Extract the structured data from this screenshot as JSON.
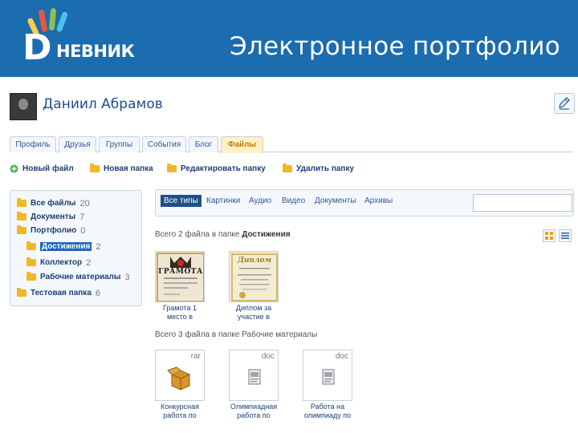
{
  "header": {
    "logo_text": "НЕВНИК",
    "logo_letter": "D",
    "title": "Электронное портфолио",
    "bg_color": "#1c6cb0"
  },
  "profile": {
    "name": "Даниил Абрамов",
    "edit_icon": "pencil-icon"
  },
  "tabs": [
    {
      "label": "Профиль"
    },
    {
      "label": "Друзья"
    },
    {
      "label": "Группы"
    },
    {
      "label": "События"
    },
    {
      "label": "Блог"
    },
    {
      "label": "Файлы",
      "active": true
    }
  ],
  "toolbar": {
    "new_file": "Новый файл",
    "new_folder": "Новая папка",
    "edit_folder": "Редактировать папку",
    "delete_folder": "Удалить папку"
  },
  "tree": [
    {
      "label": "Все файлы",
      "count": "20"
    },
    {
      "label": "Документы",
      "count": "7"
    },
    {
      "label": "Портфолио",
      "count": "0"
    },
    {
      "label": "Достижения",
      "count": "2",
      "selected": true
    },
    {
      "label": "Коллектор",
      "count": "2"
    },
    {
      "label": "Рабочие материалы",
      "count": "3"
    },
    {
      "label": "Тестовая папка",
      "count": "6"
    }
  ],
  "filter_tabs": [
    {
      "label": "Все типы",
      "active": true
    },
    {
      "label": "Картинки"
    },
    {
      "label": "Аудио"
    },
    {
      "label": "Видео"
    },
    {
      "label": "Документы"
    },
    {
      "label": "Архивы"
    }
  ],
  "search": {
    "placeholder": ""
  },
  "sections": [
    {
      "title_prefix": "Всего 2 файла в папке",
      "folder": "Достижения",
      "files": [
        {
          "name_1": "Грамота 1",
          "name_2": "место в",
          "kind": "image-gramota",
          "ext": ""
        },
        {
          "name_1": "Диплом за",
          "name_2": "участие в",
          "kind": "image-diplom",
          "ext": ""
        }
      ]
    },
    {
      "title_prefix": "Всего 3 файла в папке Рабочие материалы",
      "folder": "",
      "files": [
        {
          "name_1": "Конкурсная",
          "name_2": "работа по",
          "kind": "archive",
          "ext": "rar"
        },
        {
          "name_1": "Олимпиадная",
          "name_2": "работа по",
          "kind": "doc",
          "ext": "doc"
        },
        {
          "name_1": "Работа на",
          "name_2": "олимпиаду по",
          "kind": "doc",
          "ext": "doc"
        }
      ]
    }
  ],
  "gramota_label": "ГРАМОТА",
  "diplom_label": "Диплом",
  "colors": {
    "accent": "#1f66b8",
    "active_tab": "#fdf1c8",
    "folder": "#f2b824"
  }
}
